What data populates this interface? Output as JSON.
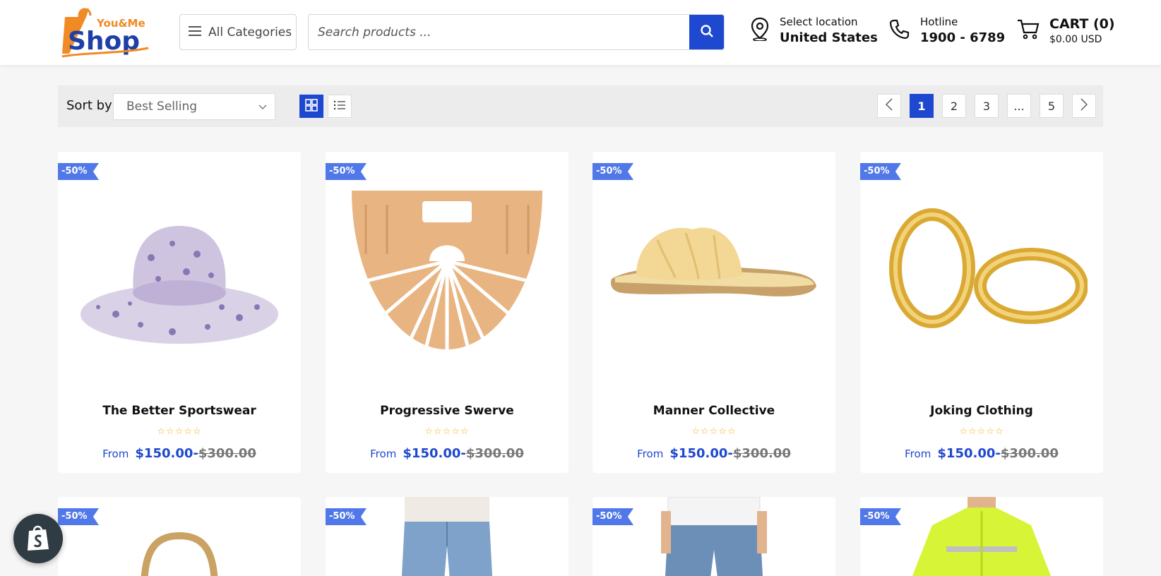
{
  "header": {
    "logo_top": "You&Me",
    "logo_main": "Shop",
    "categories_label": "All Categories",
    "search_placeholder": "Search products ...",
    "location_label": "Select location",
    "location_value": "United States",
    "hotline_label": "Hotline",
    "hotline_value": "1900 - 6789",
    "cart_label": "CART (0)",
    "cart_total": "$0.00 USD"
  },
  "toolbar": {
    "sort_label": "Sort by",
    "sort_value": "Best Selling",
    "pages": [
      "1",
      "2",
      "3",
      "...",
      "5"
    ],
    "current_page": "1"
  },
  "products": [
    {
      "name": "The Better Sportswear",
      "badge": "-50%",
      "from": "From",
      "price": "$150.00",
      "old_price": "$300.00",
      "stars": "☆☆☆☆☆",
      "icon": "bucket-hat"
    },
    {
      "name": "Progressive Swerve",
      "badge": "-50%",
      "from": "From",
      "price": "$150.00",
      "old_price": "$300.00",
      "stars": "☆☆☆☆☆",
      "icon": "bamboo-bag"
    },
    {
      "name": "Manner Collective",
      "badge": "-50%",
      "from": "From",
      "price": "$150.00",
      "old_price": "$300.00",
      "stars": "☆☆☆☆☆",
      "icon": "slide-sandal"
    },
    {
      "name": "Joking Clothing",
      "badge": "-50%",
      "from": "From",
      "price": "$150.00",
      "old_price": "$300.00",
      "stars": "☆☆☆☆☆",
      "icon": "hoop-earrings"
    }
  ],
  "products_row2": [
    {
      "badge": "-50%",
      "icon": "straw-bag"
    },
    {
      "badge": "-50%",
      "icon": "jeans-woman"
    },
    {
      "badge": "-50%",
      "icon": "jeans-man"
    },
    {
      "badge": "-50%",
      "icon": "hi-vis-jacket"
    }
  ],
  "colors": {
    "accent": "#1e48cf",
    "badge": "#5178e8",
    "star": "#f2b01e",
    "logo_orange": "#f08a24"
  }
}
